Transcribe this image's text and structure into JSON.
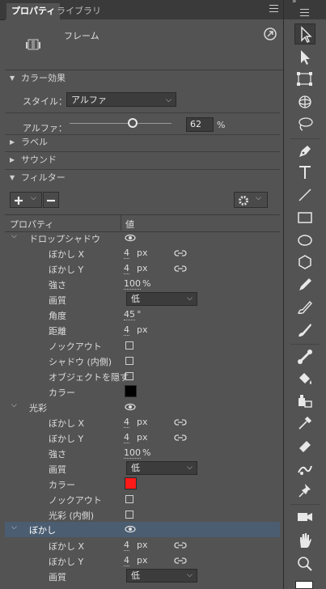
{
  "tabs": [
    {
      "label": "プロパティ",
      "active": true
    },
    {
      "label": "ライブラリ",
      "active": false
    }
  ],
  "object": {
    "type_label": "フレーム",
    "icon": "frame-symbol-icon",
    "action_icon": "open-link-icon"
  },
  "color_effect": {
    "section_label": "カラー効果",
    "style_label": "スタイル：",
    "style_value": "アルファ",
    "alpha_label": "アルファ：",
    "alpha_value": "62",
    "alpha_unit": "%",
    "alpha_fraction": 0.62
  },
  "sections": {
    "label": "ラベル",
    "sound": "サウンド",
    "filter": "フィルター"
  },
  "filter_table": {
    "col_property": "プロパティ",
    "col_value": "値"
  },
  "drop_shadow": {
    "name": "ドロップシャドウ",
    "blur_x_label": "ぼかし X",
    "blur_x": "4",
    "blur_x_unit": "px",
    "blur_y_label": "ぼかし Y",
    "blur_y": "4",
    "blur_y_unit": "px",
    "strength_label": "強さ",
    "strength": "100",
    "strength_unit": "%",
    "quality_label": "画質",
    "quality": "低",
    "angle_label": "角度",
    "angle": "45",
    "angle_unit": "°",
    "distance_label": "距離",
    "distance": "4",
    "distance_unit": "px",
    "knockout_label": "ノックアウト",
    "inner_shadow_label": "シャドウ (内側)",
    "hide_object_label": "オブジェクトを隠す",
    "color_label": "カラー",
    "color": "#000000"
  },
  "glow": {
    "name": "光彩",
    "blur_x_label": "ぼかし X",
    "blur_x": "4",
    "blur_x_unit": "px",
    "blur_y_label": "ぼかし Y",
    "blur_y": "4",
    "blur_y_unit": "px",
    "strength_label": "強さ",
    "strength": "100",
    "strength_unit": "%",
    "quality_label": "画質",
    "quality": "低",
    "color_label": "カラー",
    "color": "#ff1a1a",
    "knockout_label": "ノックアウト",
    "inner_glow_label": "光彩 (内側)"
  },
  "blur": {
    "name": "ぼかし",
    "blur_x_label": "ぼかし X",
    "blur_x": "4",
    "blur_x_unit": "px",
    "blur_y_label": "ぼかし Y",
    "blur_y": "4",
    "blur_y_unit": "px",
    "quality_label": "画質",
    "quality": "低"
  },
  "colors": {
    "panel_bg": "#535353",
    "selected_row": "#4b5d71",
    "accent_white": "#ffffff"
  },
  "tools": [
    "selection-icon",
    "subselection-icon",
    "free-transform-icon",
    "3d-rotation-icon",
    "lasso-icon",
    "pen-icon",
    "text-icon",
    "line-icon",
    "rectangle-icon",
    "oval-icon",
    "polystar-icon",
    "pencil-icon",
    "brush-icon",
    "paint-brush-icon",
    "bone-icon",
    "paint-bucket-icon",
    "ink-bottle-icon",
    "eyedropper-icon",
    "eraser-icon",
    "width-icon",
    "pin-icon",
    "camera-icon",
    "hand-icon",
    "zoom-icon"
  ]
}
